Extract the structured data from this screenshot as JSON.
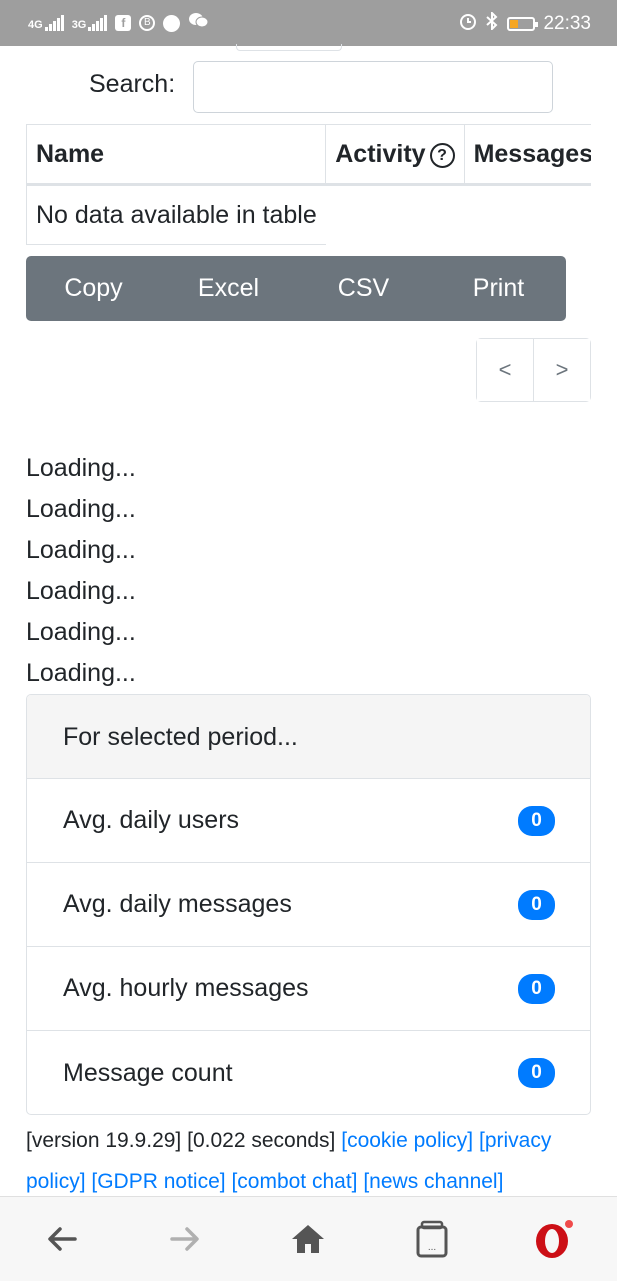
{
  "status_bar": {
    "sim1": "4G",
    "sim2": "3G",
    "time": "22:33",
    "icons": [
      "signal-icon",
      "signal-icon",
      "facebook-icon",
      "b-icon",
      "telegram-icon",
      "wechat-icon",
      "alarm-icon",
      "bluetooth-icon",
      "battery-icon"
    ]
  },
  "search": {
    "label": "Search:",
    "value": "",
    "placeholder": ""
  },
  "table": {
    "columns": [
      "Name",
      "Activity",
      "Messages"
    ],
    "empty_message": "No data available in table"
  },
  "export_buttons": {
    "copy": "Copy",
    "excel": "Excel",
    "csv": "CSV",
    "print": "Print"
  },
  "pager": {
    "prev": "<",
    "next": ">"
  },
  "loading": [
    "Loading...",
    "Loading...",
    "Loading...",
    "Loading...",
    "Loading...",
    "Loading..."
  ],
  "period_card": {
    "header": "For selected period...",
    "stats": [
      {
        "label": "Avg. daily users",
        "value": "0"
      },
      {
        "label": "Avg. daily messages",
        "value": "0"
      },
      {
        "label": "Avg. hourly messages",
        "value": "0"
      },
      {
        "label": "Message count",
        "value": "0"
      }
    ]
  },
  "footer": {
    "version": "[version 19.9.29]",
    "timing": "[0.022 seconds]",
    "cookie": "[cookie policy]",
    "privacy": "[privacy policy]",
    "gdpr": "[GDPR notice]",
    "combot": "[combot chat]",
    "news": "[news channel]"
  },
  "colors": {
    "button_gray": "#6c757d",
    "badge_blue": "#007bff",
    "link_blue": "#007bff",
    "battery_orange": "#f5a623",
    "opera_red": "#cc0f16"
  }
}
